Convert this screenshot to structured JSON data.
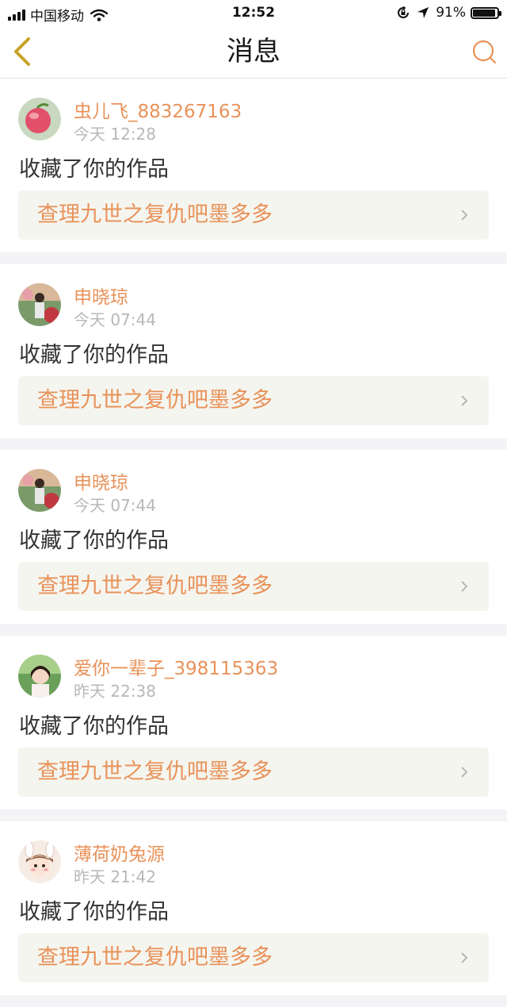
{
  "status_bar": {
    "carrier": "中国移动",
    "time": "12:52",
    "battery": "91%",
    "battery_level": 0.91,
    "icons": [
      "signal-icon",
      "wifi-icon",
      "rotation-lock-icon",
      "location-arrow-icon",
      "battery-icon"
    ]
  },
  "nav": {
    "title": "消息",
    "back_icon": "chevron-left-icon",
    "search_icon": "search-icon"
  },
  "colors": {
    "accent": "#e8925a",
    "back_arrow": "#c9a227",
    "card_link_bg": "#f5f5ef",
    "time_text": "#b8b8b8",
    "page_bg": "#f4f4f6"
  },
  "messages": [
    {
      "username": "虫儿飞_883267163",
      "time": "今天 12:28",
      "action": "收藏了你的作品",
      "work_title": "查理九世之复仇吧墨多多",
      "avatar": "avatar-peach"
    },
    {
      "username": "申晓琼",
      "time": "今天 07:44",
      "action": "收藏了你的作品",
      "work_title": "查理九世之复仇吧墨多多",
      "avatar": "avatar-photo"
    },
    {
      "username": "申晓琼",
      "time": "今天 07:44",
      "action": "收藏了你的作品",
      "work_title": "查理九世之复仇吧墨多多",
      "avatar": "avatar-photo"
    },
    {
      "username": "爱你一辈子_398115363",
      "time": "昨天 22:38",
      "action": "收藏了你的作品",
      "work_title": "查理九世之复仇吧墨多多",
      "avatar": "avatar-girl"
    },
    {
      "username": "薄荷奶兔源",
      "time": "昨天 21:42",
      "action": "收藏了你的作品",
      "work_title": "查理九世之复仇吧墨多多",
      "avatar": "avatar-cartoon"
    }
  ]
}
